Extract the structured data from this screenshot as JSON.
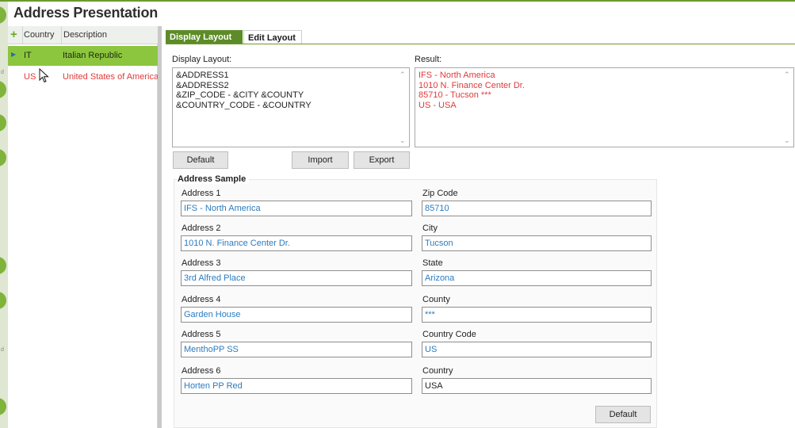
{
  "page": {
    "title": "Address Presentation"
  },
  "list": {
    "columns": [
      "Country",
      "Description"
    ],
    "rows": [
      {
        "code": "IT",
        "description": "Italian Republic",
        "selected": true
      },
      {
        "code": "US",
        "description": "United States of America",
        "selected": false
      }
    ]
  },
  "tabs": [
    "Display Layout",
    "Edit Layout"
  ],
  "display_layout": {
    "label": "Display Layout:",
    "lines": [
      "&ADDRESS1",
      "&ADDRESS2",
      "&ZIP_CODE - &CITY &COUNTY",
      "&COUNTRY_CODE - &COUNTRY"
    ]
  },
  "result": {
    "label": "Result:",
    "lines": [
      "IFS - North America",
      "1010 N. Finance Center Dr.",
      "85710 - Tucson ***",
      "US - USA"
    ]
  },
  "buttons": {
    "default": "Default",
    "import": "Import",
    "export": "Export",
    "sample_default": "Default"
  },
  "address_sample": {
    "title": "Address Sample",
    "left": [
      {
        "label": "Address 1",
        "value": "IFS - North America"
      },
      {
        "label": "Address 2",
        "value": "1010 N. Finance Center Dr."
      },
      {
        "label": "Address 3",
        "value": "3rd Alfred Place"
      },
      {
        "label": "Address 4",
        "value": "Garden House"
      },
      {
        "label": "Address 5",
        "value": "MenthoPP SS"
      },
      {
        "label": "Address 6",
        "value": "Horten PP Red"
      }
    ],
    "right": [
      {
        "label": "Zip Code",
        "value": "85710"
      },
      {
        "label": "City",
        "value": "Tucson"
      },
      {
        "label": "State",
        "value": "Arizona"
      },
      {
        "label": "County",
        "value": "***"
      },
      {
        "label": "Country Code",
        "value": "US"
      },
      {
        "label": "Country",
        "value": "USA"
      }
    ]
  },
  "colors": {
    "accent": "#6a9a2e",
    "selected_row": "#8cc63f",
    "red_text": "#e03a3a",
    "field_text": "#2b7bc0"
  }
}
